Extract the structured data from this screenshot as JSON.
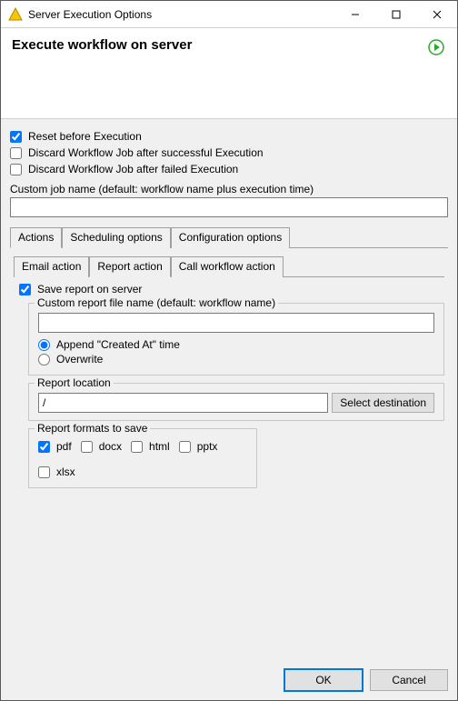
{
  "window": {
    "title": "Server Execution Options"
  },
  "header": {
    "title": "Execute workflow on server"
  },
  "options": {
    "reset_label": "Reset before Execution",
    "reset_checked": true,
    "discard_success_label": "Discard Workflow Job after successful Execution",
    "discard_success_checked": false,
    "discard_failed_label": "Discard Workflow Job after failed Execution",
    "discard_failed_checked": false,
    "custom_job_label": "Custom job name (default: workflow name plus execution time)",
    "custom_job_value": ""
  },
  "tabs": {
    "main": [
      {
        "label": "Actions",
        "active": true
      },
      {
        "label": "Scheduling options",
        "active": false
      },
      {
        "label": "Configuration options",
        "active": false
      }
    ],
    "sub": [
      {
        "label": "Email action",
        "active": false
      },
      {
        "label": "Report action",
        "active": true
      },
      {
        "label": "Call workflow action",
        "active": false
      }
    ]
  },
  "report": {
    "save_label": "Save report on server",
    "save_checked": true,
    "filename_group_label": "Custom report file name (default: workflow name)",
    "filename_value": "",
    "append_label": "Append \"Created At\" time",
    "overwrite_label": "Overwrite",
    "mode": "append",
    "location_group_label": "Report location",
    "location_value": "/",
    "select_dest_label": "Select destination",
    "formats_group_label": "Report formats to save",
    "formats": {
      "pdf": {
        "label": "pdf",
        "checked": true
      },
      "docx": {
        "label": "docx",
        "checked": false
      },
      "html": {
        "label": "html",
        "checked": false
      },
      "pptx": {
        "label": "pptx",
        "checked": false
      },
      "xlsx": {
        "label": "xlsx",
        "checked": false
      }
    }
  },
  "footer": {
    "ok_label": "OK",
    "cancel_label": "Cancel"
  }
}
